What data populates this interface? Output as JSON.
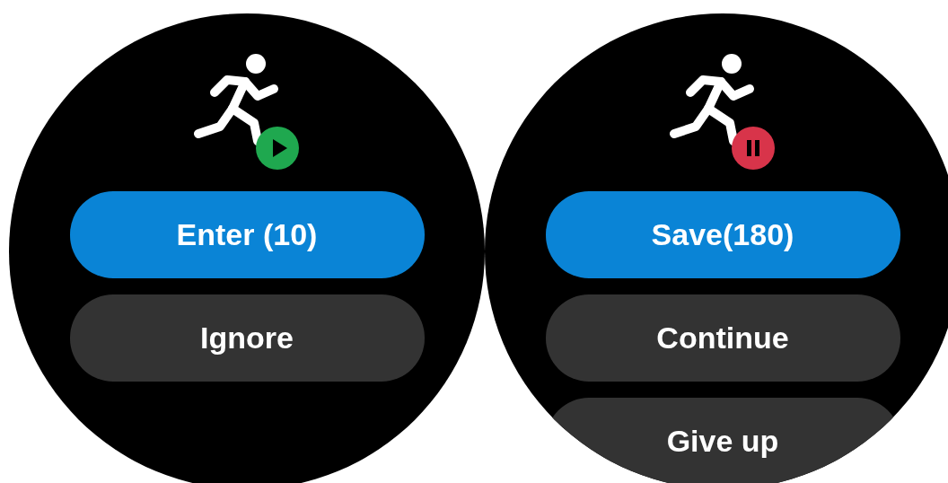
{
  "screens": [
    {
      "paused": false,
      "buttons": [
        {
          "label": "Enter (10)",
          "kind": "primary"
        },
        {
          "label": "Ignore",
          "kind": "secondary"
        }
      ]
    },
    {
      "paused": true,
      "buttons": [
        {
          "label": "Save(180)",
          "kind": "primary"
        },
        {
          "label": "Continue",
          "kind": "secondary"
        },
        {
          "label": "Give up",
          "kind": "secondary"
        }
      ]
    }
  ]
}
